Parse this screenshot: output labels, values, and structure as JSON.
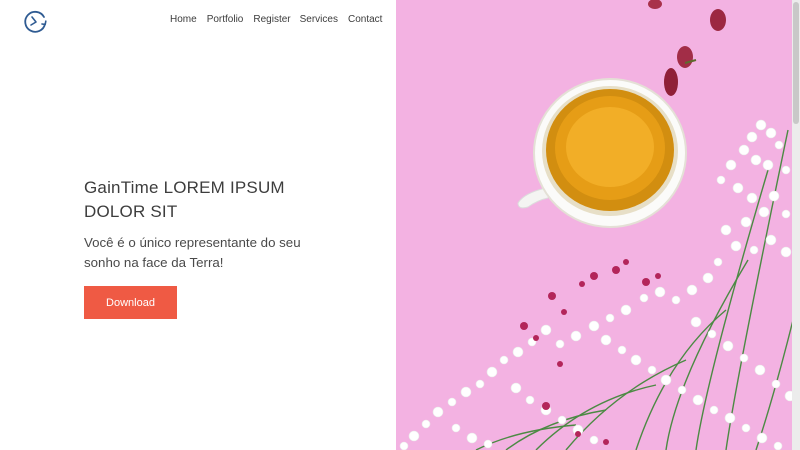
{
  "header": {
    "logo_icon": "clock-refresh-icon",
    "nav": {
      "home": "Home",
      "portfolio": "Portfolio",
      "register": "Register",
      "services": "Services",
      "contact": "Contact"
    }
  },
  "hero": {
    "title_line1": "GainTime LOREM IPSUM",
    "title_line2": "DOLOR SIT",
    "subtitle_line1": "Você é o único representante do seu",
    "subtitle_line2": "sonho na face da Terra!",
    "button_label": "Download",
    "button_color": "#ef5a44"
  },
  "image": {
    "background_color": "#f3b2e2",
    "subject": "tea-cup-with-flowers"
  }
}
